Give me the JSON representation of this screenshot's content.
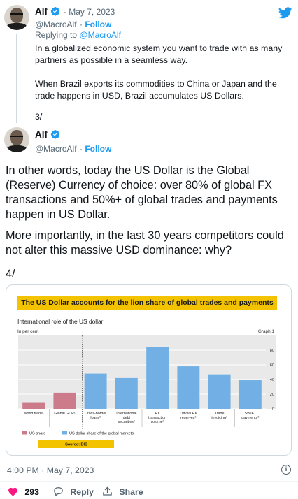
{
  "tweet1": {
    "author_name": "Alf",
    "date": "May 7, 2023",
    "handle": "@MacroAlf",
    "follow_label": "Follow",
    "replying_prefix": "Replying to",
    "replying_handle": "@MacroAlf",
    "paragraph1": "In a globalized economic system you want to trade with as many partners as possible in a seamless way.",
    "paragraph2": "When Brazil exports its commodities to China or Japan and the trade happens in USD, Brazil accumulates US Dollars.",
    "paragraph3": "3/"
  },
  "tweet2": {
    "author_name": "Alf",
    "handle": "@MacroAlf",
    "follow_label": "Follow",
    "paragraph1": "In other words, today the US Dollar is the Global (Reserve) Currency of choice: over 80% of global FX transactions and 50%+ of global trades and payments happen in US Dollar.",
    "paragraph2": "More importantly, in the last 30 years competitors could not alter this massive USD dominance: why?",
    "paragraph3": "4/",
    "timestamp": "4:00 PM · May 7, 2023"
  },
  "chart_data": {
    "type": "bar",
    "title": "The US Dollar accounts for the lion share of global trades and payments",
    "subtitle": "International role of the US dollar",
    "unit_label": "In per cent",
    "graph_label": "Graph 1",
    "source": "Source: BIS",
    "categories": [
      "World trade¹",
      "Global GDP²",
      "Cross-border loans³",
      "International debt securities⁴",
      "FX transaction volume⁵",
      "Official FX reserves⁶",
      "Trade invoicing⁷",
      "SWIFT payments⁸"
    ],
    "series": [
      {
        "name": "US share",
        "color": "#cc7b8b",
        "values": [
          9,
          22,
          null,
          null,
          null,
          null,
          null,
          null
        ]
      },
      {
        "name": "US dollar share of the global markets",
        "color": "#71afe5",
        "values": [
          null,
          null,
          48,
          42,
          84,
          58,
          47,
          39
        ]
      }
    ],
    "ylim": [
      0,
      100
    ],
    "yticks": [
      0,
      20,
      40,
      60,
      80
    ],
    "grid": true,
    "legend_position": "bottom-left"
  },
  "actions": {
    "like_count": "293",
    "reply_label": "Reply",
    "share_label": "Share"
  },
  "colors": {
    "accent": "#1d9bf0",
    "muted": "#536471",
    "like_red": "#f91880",
    "banner_yellow": "#f4c300"
  }
}
